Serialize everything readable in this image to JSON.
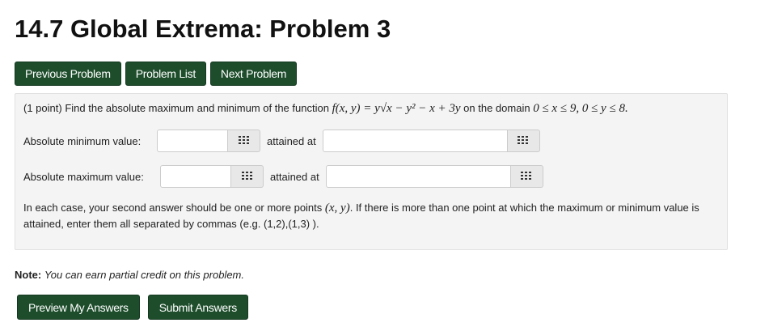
{
  "page_title": "14.7 Global Extrema: Problem 3",
  "nav": {
    "previous": "Previous Problem",
    "list": "Problem List",
    "next": "Next Problem"
  },
  "problem": {
    "points": "(1 point)",
    "statement_pre": "Find the absolute maximum and minimum of the function",
    "function": "f(x, y) = y√x − y² − x + 3y",
    "statement_mid": "on the domain",
    "domain": "0 ≤ x ≤ 9, 0 ≤ y ≤ 8.",
    "min_label": "Absolute minimum value:",
    "max_label": "Absolute maximum value:",
    "attained_label": "attained at",
    "min_value": "",
    "min_points": "",
    "max_value": "",
    "max_points": "",
    "instructions_pre": "In each case, your second answer should be one or more points",
    "instructions_point": "(x, y)",
    "instructions_post": ". If there is more than one point at which the maximum or minimum value is attained, enter them all separated by commas (e.g. (1,2),(1,3) )."
  },
  "note": {
    "label": "Note:",
    "text": "You can earn partial credit on this problem."
  },
  "actions": {
    "preview": "Preview My Answers",
    "submit": "Submit Answers"
  },
  "icons": {
    "equation_editor": "grid-icon"
  },
  "colors": {
    "button_bg": "#1d4d2b",
    "panel_bg": "#f4f4f4"
  }
}
